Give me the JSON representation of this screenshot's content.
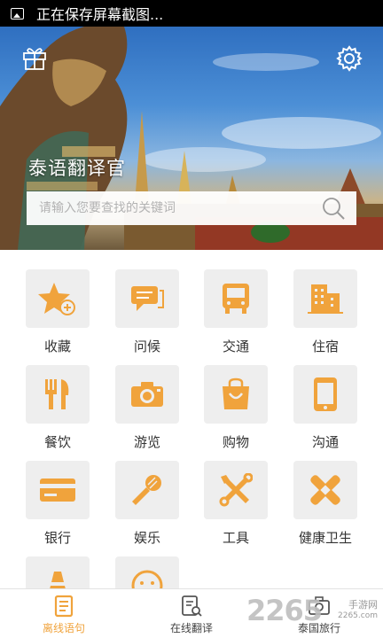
{
  "status_bar": {
    "text": "正在保存屏幕截图..."
  },
  "header": {
    "title": "泰语翻译官",
    "gift_icon": "gift-icon",
    "settings_icon": "gear-icon"
  },
  "search": {
    "placeholder": "请输入您要查找的关键词",
    "value": ""
  },
  "colors": {
    "accent": "#f0a33c",
    "tile_bg": "#eeeeee"
  },
  "grid": [
    {
      "label": "收藏",
      "icon": "star-plus-icon"
    },
    {
      "label": "问候",
      "icon": "chat-bubbles-icon"
    },
    {
      "label": "交通",
      "icon": "bus-icon"
    },
    {
      "label": "住宿",
      "icon": "building-icon"
    },
    {
      "label": "餐饮",
      "icon": "fork-knife-icon"
    },
    {
      "label": "游览",
      "icon": "camera-icon"
    },
    {
      "label": "购物",
      "icon": "shopping-bag-icon"
    },
    {
      "label": "沟通",
      "icon": "phone-icon"
    },
    {
      "label": "银行",
      "icon": "bank-card-icon"
    },
    {
      "label": "娱乐",
      "icon": "microphone-icon"
    },
    {
      "label": "工具",
      "icon": "tools-icon"
    },
    {
      "label": "健康卫生",
      "icon": "bandage-icon"
    },
    {
      "label": "",
      "icon": "traffic-cone-icon"
    },
    {
      "label": "",
      "icon": "sad-face-icon"
    }
  ],
  "bottom_nav": [
    {
      "label": "离线语句",
      "icon": "offline-phrases-icon",
      "active": true
    },
    {
      "label": "在线翻译",
      "icon": "online-translate-icon",
      "active": false
    },
    {
      "label": "泰国旅行",
      "icon": "travel-camera-icon",
      "active": false
    }
  ],
  "watermark": {
    "number": "2265",
    "name": "手游网",
    "url": "2265.com"
  }
}
